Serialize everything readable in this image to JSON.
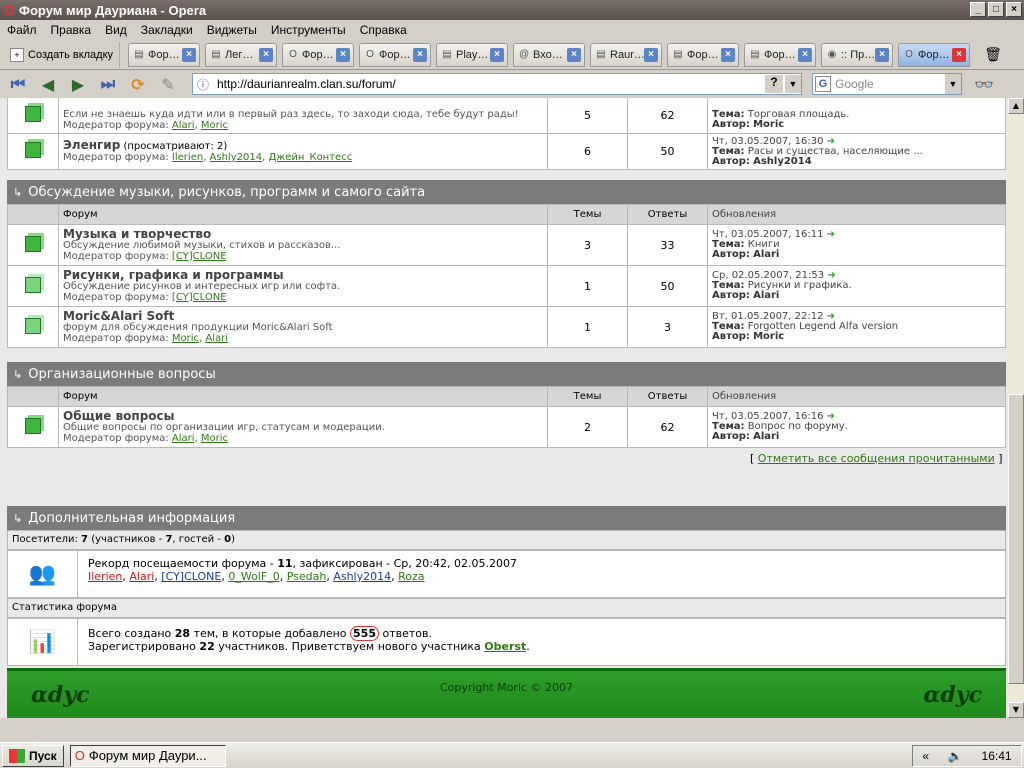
{
  "window": {
    "title": "Форум мир Дауриана - Opera"
  },
  "menu": [
    "Файл",
    "Правка",
    "Вид",
    "Закладки",
    "Виджеты",
    "Инструменты",
    "Справка"
  ],
  "tabs": {
    "new_tab": "Создать вкладку",
    "items": [
      {
        "label": "Фор…",
        "icon": "page-icon"
      },
      {
        "label": "Лег…",
        "icon": "page-icon"
      },
      {
        "label": "Фор…",
        "icon": "opera-icon"
      },
      {
        "label": "Фор…",
        "icon": "opera-icon"
      },
      {
        "label": "Play…",
        "icon": "page-icon"
      },
      {
        "label": "Вхо…",
        "icon": "at-icon"
      },
      {
        "label": "Raur…",
        "icon": "page-icon"
      },
      {
        "label": "Фор…",
        "icon": "page-icon"
      },
      {
        "label": "Фор…",
        "icon": "page-icon"
      },
      {
        "label": ":: Пр…",
        "icon": "globe-icon"
      },
      {
        "label": "Фор…",
        "icon": "opera-icon",
        "active": true
      }
    ]
  },
  "address": {
    "url": "http://daurianrealm.clan.su/forum/",
    "search_placeholder": "Google"
  },
  "top_rows": [
    {
      "title": "",
      "desc": "Если не знаешь куда идти или в первый раз здесь, то заходи сюда, тебе будут рады!",
      "mod_label": "Модератор форума:",
      "mods": [
        "Alari",
        "Moric"
      ],
      "topics": "5",
      "replies": "62",
      "upd_date": "",
      "upd_topic_label": "Тема:",
      "upd_topic": "Торговая площадь.",
      "upd_author_label": "Автор:",
      "upd_author": "Moric"
    },
    {
      "title": "Эленгир",
      "watching": "(просматривают: 2)",
      "desc": "",
      "mod_label": "Модератор форума:",
      "mods": [
        "Ilerien",
        "Ashly2014",
        "Джейн_Контесс"
      ],
      "topics": "6",
      "replies": "50",
      "upd_date": "Чт, 03.05.2007, 16:30",
      "upd_topic_label": "Тема:",
      "upd_topic": "Расы и существа, населяющие ...",
      "upd_author_label": "Автор:",
      "upd_author": "Ashly2014"
    }
  ],
  "cols": {
    "forum": "Форум",
    "topics": "Темы",
    "replies": "Ответы",
    "updates": "Обновления"
  },
  "section1": {
    "title": "Обсуждение музыки, рисунков, программ и самого сайта",
    "rows": [
      {
        "title": "Музыка и творчество",
        "desc": "Обсуждение любимой музыки, стихов и рассказов...",
        "mod_label": "Модератор форума:",
        "mods": [
          "[CY]CLONE"
        ],
        "topics": "3",
        "replies": "33",
        "upd_date": "Чт, 03.05.2007, 16:11",
        "upd_topic_label": "Тема:",
        "upd_topic": "Книги",
        "upd_author_label": "Автор:",
        "upd_author": "Alari"
      },
      {
        "title": "Рисунки, графика и программы",
        "desc": "Обсуждение рисунков и интересных игр или софта.",
        "mod_label": "Модератор форума:",
        "mods": [
          "[CY]CLONE"
        ],
        "topics": "1",
        "replies": "50",
        "upd_date": "Ср, 02.05.2007, 21:53",
        "upd_topic_label": "Тема:",
        "upd_topic": "Рисунки и графика.",
        "upd_author_label": "Автор:",
        "upd_author": "Alari"
      },
      {
        "title": "Moric&Alari Soft",
        "desc": "форум для обсуждения продукции Moric&Alari Soft",
        "mod_label": "Модератор форума:",
        "mods": [
          "Moric",
          "Alari"
        ],
        "topics": "1",
        "replies": "3",
        "upd_date": "Вт, 01.05.2007, 22:12",
        "upd_topic_label": "Тема:",
        "upd_topic": "Forgotten Legend Alfa version",
        "upd_author_label": "Автор:",
        "upd_author": "Moric"
      }
    ]
  },
  "section2": {
    "title": "Организационные вопросы",
    "rows": [
      {
        "title": "Общие вопросы",
        "desc": "Общие вопросы по организации игр, статусам и модерации.",
        "mod_label": "Модератор форума:",
        "mods": [
          "Alari",
          "Moric"
        ],
        "topics": "2",
        "replies": "62",
        "upd_date": "Чт, 03.05.2007, 16:16",
        "upd_topic_label": "Тема:",
        "upd_topic": "Вопрос по форуму.",
        "upd_author_label": "Автор:",
        "upd_author": "Alari"
      }
    ]
  },
  "mark_read": "Отметить все сообщения прочитанными",
  "info": {
    "title": "Дополнительная информация",
    "visitors_label": "Посетители:",
    "visitors": "7",
    "visitors_detail_a": "(участников -",
    "members": "7",
    "visitors_detail_b": ", гостей -",
    "guests": "0",
    "visitors_detail_c": ")",
    "record_a": "Рекорд посещаемости форума -",
    "record_num": "11",
    "record_b": ", зафиксирован - Ср, 20:42, 02.05.2007",
    "online_users": [
      {
        "name": "Ilerien",
        "color": "red"
      },
      {
        "name": "Alari",
        "color": "red"
      },
      {
        "name": "[CY]CLONE",
        "color": "blue"
      },
      {
        "name": "0_WolF_0",
        "color": "green"
      },
      {
        "name": "Psedah",
        "color": "green"
      },
      {
        "name": "Ashly2014",
        "color": "blue"
      },
      {
        "name": "Roza",
        "color": "green"
      }
    ],
    "stats_label": "Статистика форума",
    "stats_a": "Всего создано",
    "stats_topics": "28",
    "stats_b": "тем, в которые добавлено",
    "stats_posts": "555",
    "stats_c": "ответов.",
    "reg_a": "Зарегистрировано",
    "reg_num": "22",
    "reg_b": "участников. Приветствуем нового участника",
    "newest": "Oberst",
    "reg_c": "."
  },
  "footer": {
    "copyright": "Copyright Moric © 2007",
    "logo_text": "ɑdyc"
  },
  "taskbar": {
    "start": "Пуск",
    "item": "Форум мир Даури...",
    "time": "16:41",
    "tray_arrow": "«"
  }
}
